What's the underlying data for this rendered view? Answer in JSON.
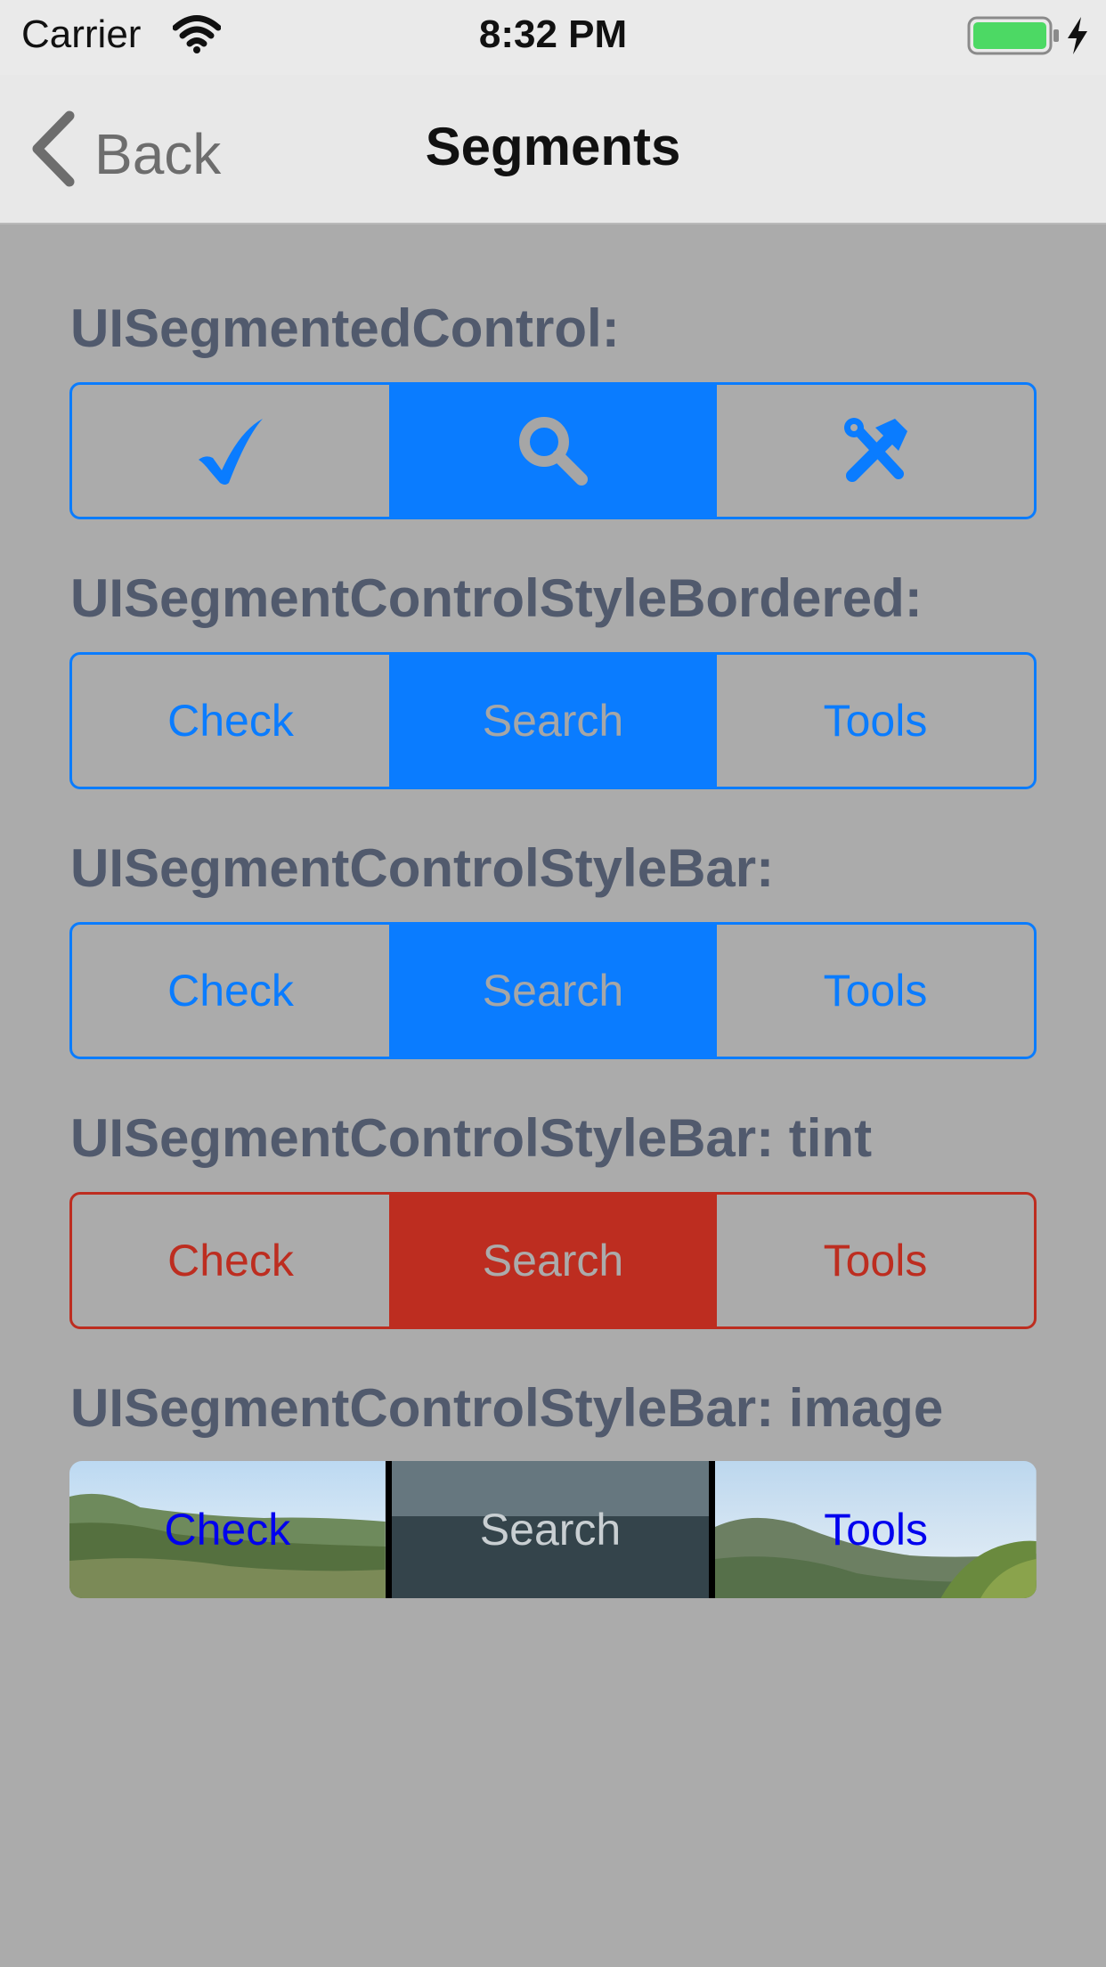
{
  "status_bar": {
    "carrier": "Carrier",
    "time": "8:32 PM",
    "battery_color": "#4cd964"
  },
  "nav": {
    "back_label": "Back",
    "title": "Segments"
  },
  "sections": [
    {
      "label": "UISegmentedControl:",
      "style": "icons",
      "tint": "#0a7cff",
      "segments": [
        {
          "icon": "checkmark-icon",
          "selected": false
        },
        {
          "icon": "magnifier-icon",
          "selected": true
        },
        {
          "icon": "tools-icon",
          "selected": false
        }
      ]
    },
    {
      "label": "UISegmentControlStyleBordered:",
      "style": "text",
      "tint": "#0a7cff",
      "segments": [
        {
          "label": "Check",
          "selected": false
        },
        {
          "label": "Search",
          "selected": true
        },
        {
          "label": "Tools",
          "selected": false
        }
      ]
    },
    {
      "label": "UISegmentControlStyleBar:",
      "style": "text",
      "tint": "#0a7cff",
      "segments": [
        {
          "label": "Check",
          "selected": false
        },
        {
          "label": "Search",
          "selected": true
        },
        {
          "label": "Tools",
          "selected": false
        }
      ]
    },
    {
      "label": "UISegmentControlStyleBar: tint",
      "style": "text",
      "tint": "#bd2d20",
      "segments": [
        {
          "label": "Check",
          "selected": false
        },
        {
          "label": "Search",
          "selected": true
        },
        {
          "label": "Tools",
          "selected": false
        }
      ]
    },
    {
      "label": "UISegmentControlStyleBar: image",
      "style": "image",
      "label_color": "#0000ee",
      "segments": [
        {
          "label": "Check",
          "selected": false
        },
        {
          "label": "Search",
          "selected": true
        },
        {
          "label": "Tools",
          "selected": false
        }
      ]
    }
  ]
}
